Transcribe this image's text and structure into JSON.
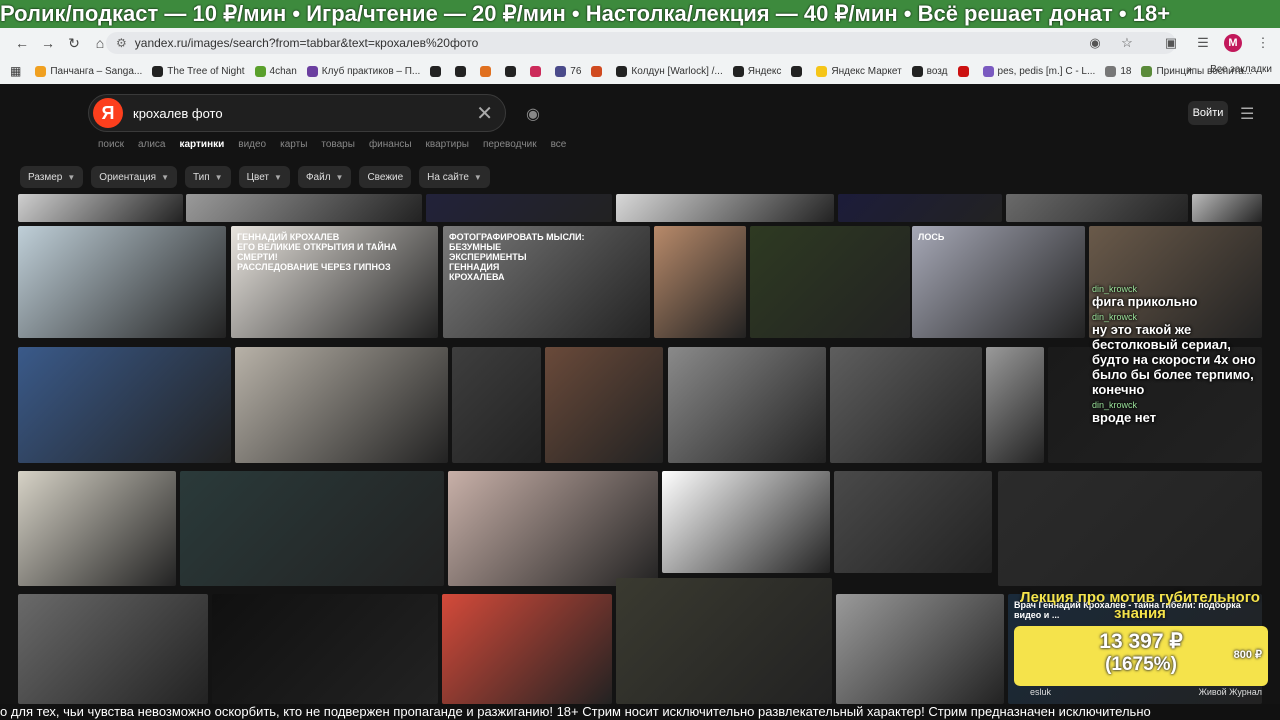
{
  "overlay": {
    "ticker_top": "Ролик/подкаст — 10 ₽/мин • Игра/чтение — 20 ₽/мин • Настолка/лекция — 40 ₽/мин • Всё решает донат • 18+",
    "ticker_bottom": "о для тех, чьи чувства невозможно оскорбить, кто не подвержен пропаганде и разжиганию! 18+ Стрим носит исключительно развлекательный характер! Стрим предназначен исключительно"
  },
  "browser": {
    "url": "yandex.ru/images/search?from=tabbar&text=крохалев%20фото",
    "avatar_letter": "M",
    "bookmarks": [
      {
        "label": "Панчанга – Sanga...",
        "color": "#f0a020"
      },
      {
        "label": "The Tree of Night",
        "color": "#222222"
      },
      {
        "label": "4chan",
        "color": "#5aa02c"
      },
      {
        "label": "Клуб практиков – П...",
        "color": "#6b3fa0"
      },
      {
        "label": "",
        "color": "#222222"
      },
      {
        "label": "",
        "color": "#222222"
      },
      {
        "label": "",
        "color": "#e07020"
      },
      {
        "label": "",
        "color": "#222222"
      },
      {
        "label": "",
        "color": "#cc2a5a"
      },
      {
        "label": "76",
        "color": "#4a4a8a"
      },
      {
        "label": "",
        "color": "#d04a20"
      },
      {
        "label": "Колдун [Warlock] /...",
        "color": "#222222"
      },
      {
        "label": "Яндекс",
        "color": "#222222"
      },
      {
        "label": "",
        "color": "#222222"
      },
      {
        "label": "Яндекс Маркет",
        "color": "#f5c518"
      },
      {
        "label": "возд",
        "color": "#222222"
      },
      {
        "label": "",
        "color": "#cc1111"
      },
      {
        "label": "pes, pedis [m.] C - L...",
        "color": "#7a5ac0"
      },
      {
        "label": "18",
        "color": "#777777"
      },
      {
        "label": "Принципы воспита...",
        "color": "#5a8a3a"
      }
    ],
    "bookmarks_right": "Все закладки"
  },
  "search": {
    "logo": "Я",
    "query": "крохалев фото",
    "login_label": "Войти",
    "tabs": [
      {
        "label": "поиск",
        "active": false
      },
      {
        "label": "алиса",
        "active": false
      },
      {
        "label": "картинки",
        "active": true
      },
      {
        "label": "видео",
        "active": false
      },
      {
        "label": "карты",
        "active": false
      },
      {
        "label": "товары",
        "active": false
      },
      {
        "label": "финансы",
        "active": false
      },
      {
        "label": "квартиры",
        "active": false
      },
      {
        "label": "переводчик",
        "active": false
      },
      {
        "label": "все",
        "active": false
      }
    ],
    "filters": [
      {
        "label": "Размер",
        "chevron": true
      },
      {
        "label": "Ориентация",
        "chevron": true
      },
      {
        "label": "Тип",
        "chevron": true
      },
      {
        "label": "Цвет",
        "chevron": true
      },
      {
        "label": "Файл",
        "chevron": true
      },
      {
        "label": "Свежие",
        "chevron": false
      },
      {
        "label": "На сайте",
        "chevron": true
      }
    ]
  },
  "images": [
    {
      "bg": "#cfcfcf"
    },
    {
      "bg": "#9a9a9a"
    },
    {
      "bg": "#22223a"
    },
    {
      "bg": "#d8d8d8"
    },
    {
      "bg": "#1c1c3a"
    },
    {
      "bg": "#6a6a6a"
    },
    {
      "bg": "#bbbbbb"
    },
    {
      "bg": "#bfcfd8"
    },
    {
      "bg": "#e8e4de",
      "caption": "ГЕННАДИЙ КРОХАЛЕВ\nЕГО ВЕЛИКИЕ ОТКРЫТИЯ И ТАЙНА СМЕРТИ!\nРАССЛЕДОВАНИЕ ЧЕРЕЗ ГИПНОЗ"
    },
    {
      "bg": "#7a7a7a",
      "caption": "ФОТОГРАФИРОВАТЬ МЫСЛИ:\nБЕЗУМНЫЕ\nЭКСПЕРИМЕНТЫ\nГЕННАДИЯ\nКРОХАЛЕВА"
    },
    {
      "bg": "#b88a6a"
    },
    {
      "bg": "#2e3a22"
    },
    {
      "bg": "#a6a8b6",
      "caption": "ЛОСЬ"
    },
    {
      "bg": "#6a5a4a"
    },
    {
      "bg": "#3a5a8a"
    },
    {
      "bg": "#b8b2a8"
    },
    {
      "bg": "#3e3e3e"
    },
    {
      "bg": "#6a4a3a"
    },
    {
      "bg": "#8a8a8a"
    },
    {
      "bg": "#5e5e5e"
    },
    {
      "bg": "#9a9a9a"
    },
    {
      "bg": "#1a1a1a"
    },
    {
      "bg": "#d6d2c6"
    },
    {
      "bg": "#2a3a3a"
    },
    {
      "bg": "#c8b0a8"
    },
    {
      "bg": "#ffffff"
    },
    {
      "bg": "#4a4a4a"
    },
    {
      "bg": "#2b2b2b"
    },
    {
      "bg": "#6a6a6a"
    },
    {
      "bg": "#101010"
    },
    {
      "bg": "#d44a3a"
    },
    {
      "bg": "#3a3a30"
    },
    {
      "bg": "#9a9a9a"
    },
    {
      "bg": "#1a2a3a",
      "caption": "Врач Геннадий Крохалев - тайна гибели: подборка видео и ..."
    }
  ],
  "chat": {
    "messages": [
      {
        "user": "din_krowck",
        "text": "фига прикольно"
      },
      {
        "user": "din_krowck",
        "text": "ну это такой же бестолковый сериал, будто на скорости 4х оно было бы более терпимо, конечно"
      },
      {
        "user": "din_krowck",
        "text": "вроде нет"
      }
    ]
  },
  "donation": {
    "title": "Лекция про мотив губительного знания",
    "amount": "13 397 ₽",
    "percent": "(1675%)",
    "goal": "800 ₽",
    "left": "esluk",
    "right": "Живой Журнал"
  }
}
